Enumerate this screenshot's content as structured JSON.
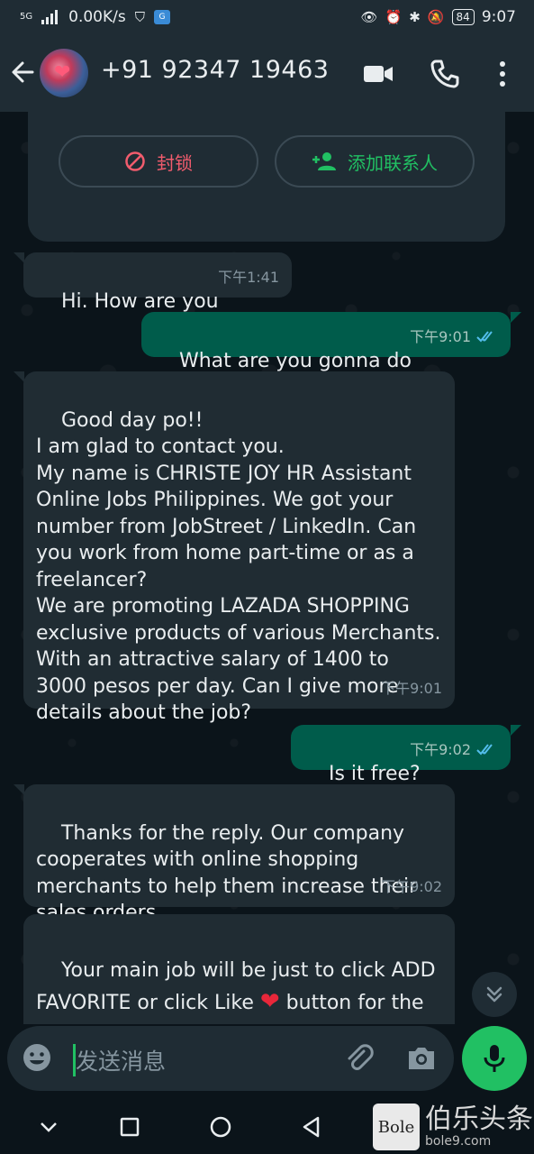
{
  "status_bar": {
    "network": "5G",
    "speed": "0.00K/s",
    "battery": "84",
    "time": "9:07"
  },
  "header": {
    "contact": "+91 92347 19463",
    "icons": [
      "back-arrow-icon",
      "video-call-icon",
      "voice-call-icon",
      "more-options-icon"
    ]
  },
  "contact_card": {
    "block_label": "封锁",
    "add_contact_label": "添加联系人"
  },
  "messages": [
    {
      "direction": "in",
      "text": "Hi. How are you",
      "time": "下午1:41"
    },
    {
      "direction": "out",
      "text": "What are you gonna do",
      "time": "下午9:01",
      "status": "read"
    },
    {
      "direction": "in",
      "text": "Good day po!!\nI am glad to contact you.\nMy name is CHRISTE JOY HR Assistant Online Jobs Philippines. We got your number from JobStreet / LinkedIn. Can you work from home part-time or as a freelancer?\nWe are promoting LAZADA SHOPPING exclusive products of various Merchants. With an attractive salary of 1400 to 3000 pesos per day. Can I give more details about the job?",
      "time": "下午9:01"
    },
    {
      "direction": "out",
      "text": "Is it free?",
      "time": "下午9:02",
      "status": "read"
    },
    {
      "direction": "in",
      "text": "Thanks for the reply. Our company cooperates with online shopping merchants to help them increase their sales orders.",
      "time": "下午9:02"
    },
    {
      "direction": "in",
      "text_part1": "Your main job will be just to click ADD FAVORITE or click Like ",
      "emoji": "❤",
      "text_part2": " button for the merchants on specified products of [Shopping Website] we now..."
    }
  ],
  "composer": {
    "placeholder": "发送消息"
  },
  "watermark": {
    "logo_text": "Bole",
    "name": "伯乐头条",
    "url": "bole9.com"
  },
  "colors": {
    "background": "#0b141a",
    "bar": "#1f2c34",
    "incoming": "#202c33",
    "outgoing": "#005c4b",
    "accent": "#21c063",
    "danger": "#f15c6d",
    "read_tick": "#53bdeb"
  }
}
